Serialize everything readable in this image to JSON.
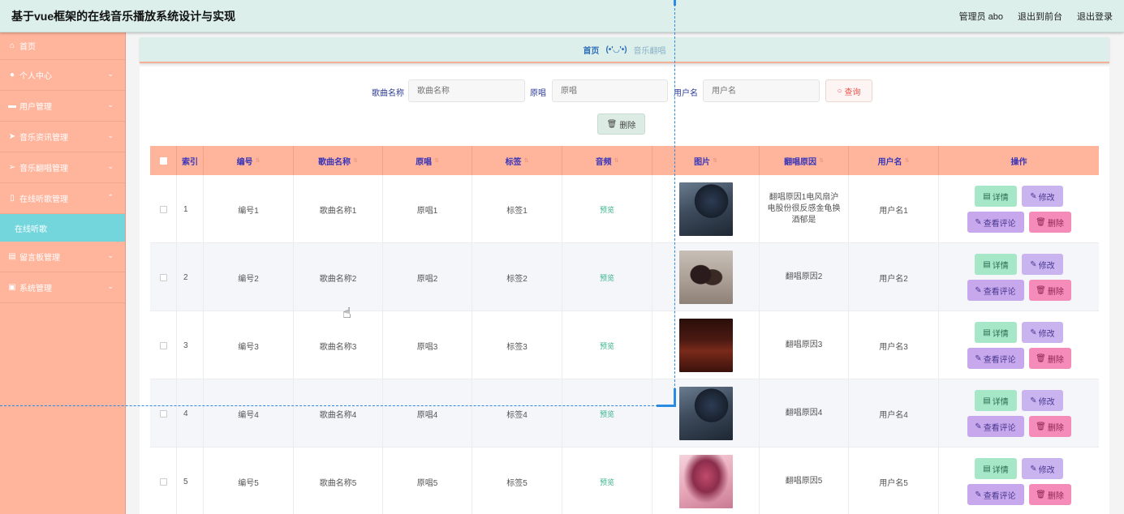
{
  "header": {
    "title": "基于vue框架的在线音乐播放系统设计与实现",
    "user": "管理员 abo",
    "to_front": "退出到前台",
    "logout": "退出登录"
  },
  "sidebar": {
    "items": [
      {
        "label": "首页",
        "icon": "home-icon"
      },
      {
        "label": "个人中心",
        "icon": "user-icon"
      },
      {
        "label": "用户管理",
        "icon": "ticket-icon"
      },
      {
        "label": "音乐资讯管理",
        "icon": "send-icon"
      },
      {
        "label": "音乐翻唱管理",
        "icon": "navigation-icon"
      },
      {
        "label": "在线听歌管理",
        "icon": "phone-icon"
      }
    ],
    "active_sub": "在线听歌",
    "items_after": [
      {
        "label": "留言板管理",
        "icon": "clipboard-icon"
      },
      {
        "label": "系统管理",
        "icon": "briefcase-icon"
      }
    ]
  },
  "breadcrumb": {
    "home": "首页",
    "separator": "(•'◡'•)",
    "current": "音乐翻唱"
  },
  "search": {
    "song_label": "歌曲名称",
    "song_placeholder": "歌曲名称",
    "original_label": "原唱",
    "original_placeholder": "原唱",
    "user_label": "用户名",
    "user_placeholder": "用户名",
    "query_button": "查询",
    "delete_button": "删除"
  },
  "table": {
    "headers": [
      "索引",
      "编号",
      "歌曲名称",
      "原唱",
      "标签",
      "音频",
      "图片",
      "翻唱原因",
      "用户名",
      "操作"
    ],
    "rows": [
      {
        "index": "1",
        "code": "编号1",
        "song": "歌曲名称1",
        "original": "原唱1",
        "tag": "标签1",
        "audio": "预览",
        "reason": "翻唱原因1电风扇沪电股份很反感金龟换酒郁是",
        "user": "用户名1"
      },
      {
        "index": "2",
        "code": "编号2",
        "song": "歌曲名称2",
        "original": "原唱2",
        "tag": "标签2",
        "audio": "预览",
        "reason": "翻唱原因2",
        "user": "用户名2"
      },
      {
        "index": "3",
        "code": "编号3",
        "song": "歌曲名称3",
        "original": "原唱3",
        "tag": "标签3",
        "audio": "预览",
        "reason": "翻唱原因3",
        "user": "用户名3"
      },
      {
        "index": "4",
        "code": "编号4",
        "song": "歌曲名称4",
        "original": "原唱4",
        "tag": "标签4",
        "audio": "预览",
        "reason": "翻唱原因4",
        "user": "用户名4"
      },
      {
        "index": "5",
        "code": "编号5",
        "song": "歌曲名称5",
        "original": "原唱5",
        "tag": "标签5",
        "audio": "预览",
        "reason": "翻唱原因5",
        "user": "用户名5"
      }
    ],
    "actions": {
      "detail": "详情",
      "edit": "修改",
      "comments": "查看评论",
      "delete": "删除"
    }
  },
  "colors": {
    "sidebar_bg": "#ffb49c",
    "active_sub_bg": "#72d6dc",
    "header_bg": "#dcefea",
    "table_head_bg": "#ffb49c"
  }
}
